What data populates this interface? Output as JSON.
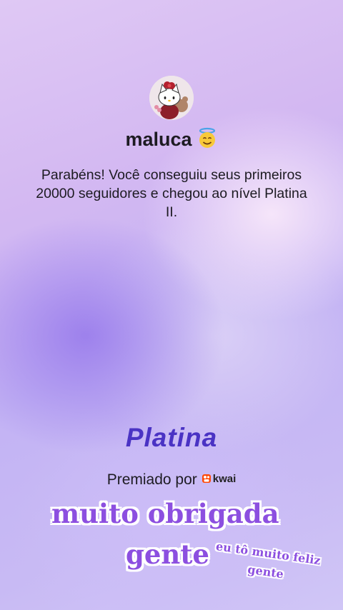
{
  "profile": {
    "username": "maluca",
    "username_emoji": "smiling-face-with-halo"
  },
  "message": "Parabéns! Você conseguiu seus primeiros 20000 seguidores e chegou ao nível Platina II.",
  "level": {
    "name": "Platina"
  },
  "award": {
    "label": "Premiado por",
    "brand": "kwai",
    "brand_color": "#ff4906"
  },
  "stickers": {
    "main_line1": "muito obrigada",
    "main_line2": "gente",
    "small_line1": "eu tô muito feliz",
    "small_line2": "gente",
    "color": "#8c4fe0"
  }
}
